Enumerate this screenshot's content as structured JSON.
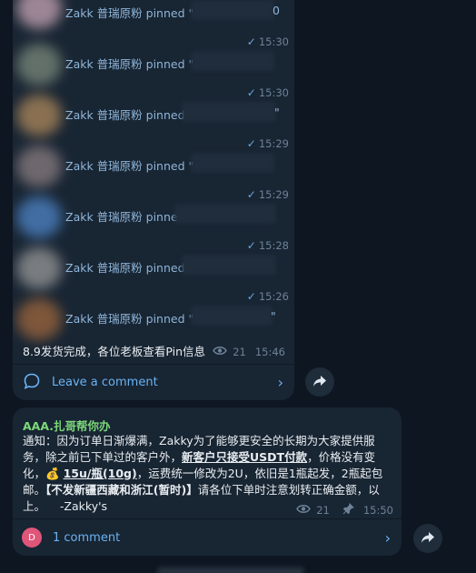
{
  "pins": [
    {
      "text": "Zakk 普瑞原粉 pinned \"",
      "time": "15:30"
    },
    {
      "text": "Zakk 普瑞原粉 pinned \"",
      "time": "15:30"
    },
    {
      "text": "Zakk 普瑞原粉 pinned",
      "time": "15:29"
    },
    {
      "text": "Zakk 普瑞原粉 pinned \"",
      "time": "15:29"
    },
    {
      "text": "Zakk 普瑞原粉 pinne",
      "time": "15:28"
    },
    {
      "text": "Zakk 普瑞原粉 pinned",
      "time": "15:26"
    },
    {
      "text": "Zakk 普瑞原粉 pinned \"",
      "time": ""
    }
  ],
  "pin_tails": [
    "0",
    "\"",
    "\""
  ],
  "post1": {
    "text": "8.9发货完成，各位老板查看Pin信息",
    "views": "21",
    "time": "15:46",
    "comment_label": "Leave a comment"
  },
  "post2": {
    "sender": "AAA.扎哥帮你办",
    "body_part1": "通知：因为订单日渐爆满，Zakky为了能够更安全的长期为大家提供服务，除之前已下单过的客户外，",
    "body_bold1": "新客户只接受USDT付款",
    "body_part2": "，价格没有变化，",
    "money_icon": "💰",
    "body_bold2": "15u/瓶(10g)",
    "body_part3": "，运费统一修改为2U，依旧是1瓶起发，2瓶起包邮。",
    "body_bold3": "【不发新疆西藏和浙江(暂时)】",
    "body_part4": "请各位下单时注意划转正确金额，以上。",
    "signature": "-Zakky's",
    "views": "21",
    "time": "15:50",
    "comment_avatar_letter": "D",
    "comment_label": "1 comment"
  },
  "colors": {
    "background": "#0e1621",
    "bubble": "#182533",
    "link": "#6ab3f3",
    "sender": "#7dd87a",
    "avatar_comment": "#e0567a"
  }
}
